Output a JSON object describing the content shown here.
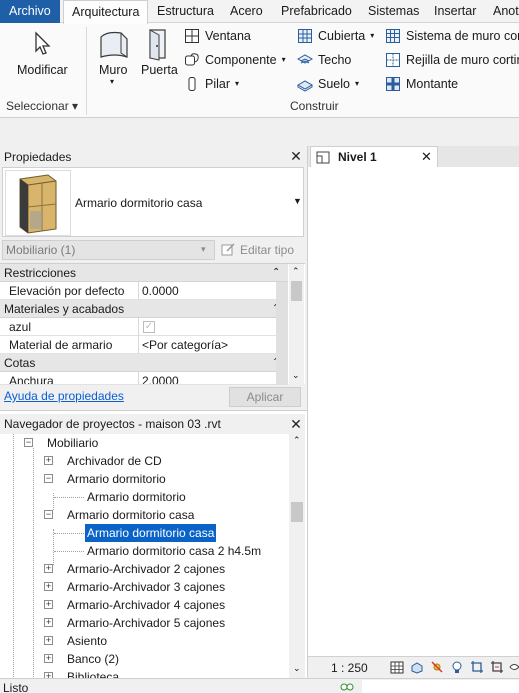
{
  "tabs": [
    "Archivo",
    "Arquitectura",
    "Estructura",
    "Acero",
    "Prefabricado",
    "Sistemas",
    "Insertar",
    "Anot"
  ],
  "ribbon": {
    "modify_label": "Modificar",
    "select_label": "Seleccionar ▾",
    "wall_label": "Muro",
    "door_label": "Puerta",
    "window_label": "Ventana",
    "component_label": "Componente",
    "column_label": "Pilar",
    "roof_label": "Cubierta",
    "ceiling_label": "Techo",
    "floor_label": "Suelo",
    "curtain_system_label": "Sistema de muro cort",
    "curtain_grid_label": "Rejilla de muro cortin",
    "mullion_label": "Montante",
    "build_panel_title": "Construir"
  },
  "properties": {
    "title": "Propiedades",
    "type_name": "Armario dormitorio casa",
    "filter_value": "Mobiliario (1)",
    "edit_type_label": "Editar tipo",
    "cat_restrictions": "Restricciones",
    "elevation_label": "Elevación por defecto",
    "elevation_value": "0.0000",
    "cat_materials": "Materiales y acabados",
    "azul_label": "azul",
    "material_label": "Material de armario",
    "material_value": "<Por categoría>",
    "cat_dimensions": "Cotas",
    "width_label": "Anchura",
    "width_value": "2.0000",
    "help_link": "Ayuda de propiedades",
    "apply_label": "Aplicar"
  },
  "view": {
    "tab_label": "Nivel 1",
    "scale": "1 : 250"
  },
  "browser": {
    "title": "Navegador de proyectos - maison 03 .rvt",
    "items": [
      "Mobiliario",
      "Archivador de CD",
      "Armario dormitorio",
      "Armario dormitorio",
      "Armario dormitorio casa",
      "Armario dormitorio casa",
      "Armario dormitorio casa 2 h4.5m",
      "Armario-Archivador 2 cajones",
      "Armario-Archivador 3 cajones",
      "Armario-Archivador 4 cajones",
      "Armario-Archivador 5 cajones",
      "Asiento",
      "Banco (2)",
      "Biblioteca"
    ]
  },
  "status": {
    "text": "Listo"
  },
  "colors": {
    "file_tab": "#1f5fa8",
    "selection": "#0a64c8",
    "link": "#0b5fd3"
  }
}
